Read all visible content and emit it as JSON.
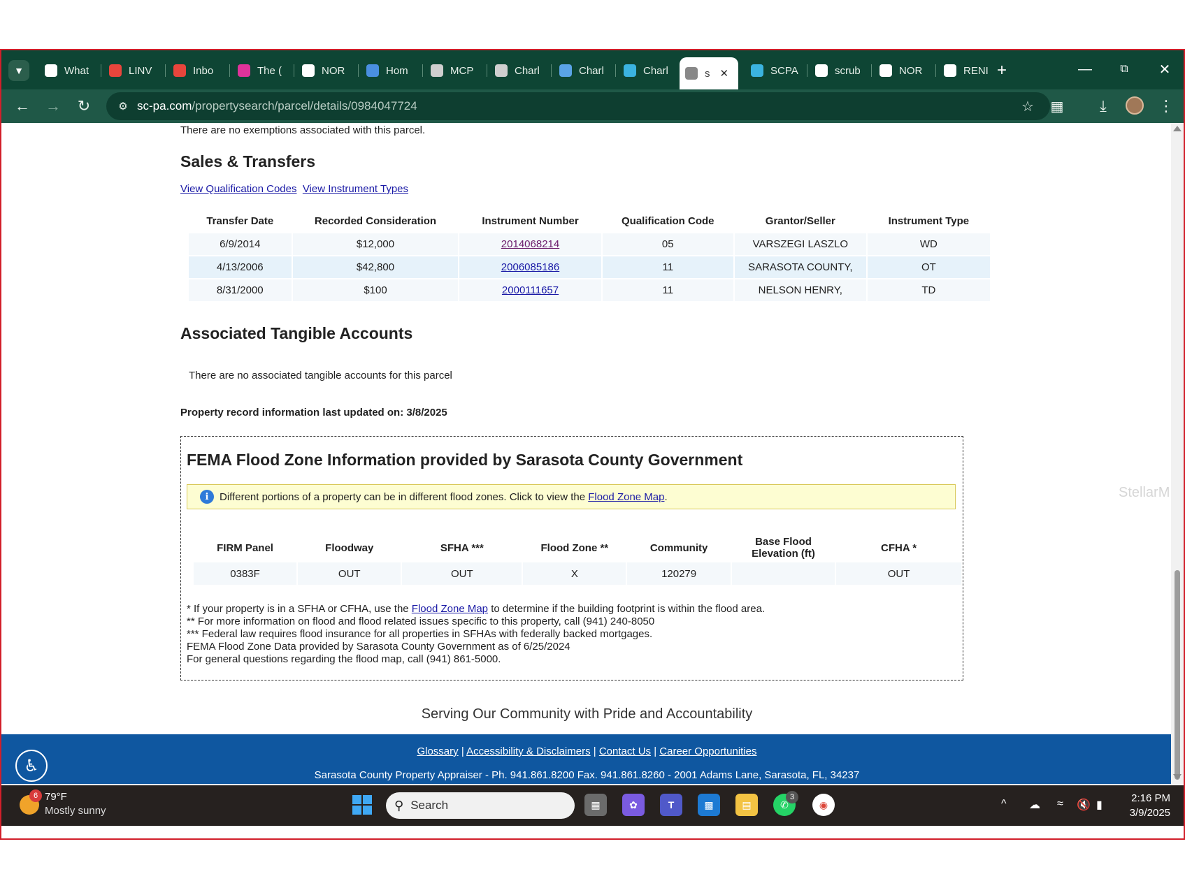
{
  "browser": {
    "tabs": [
      {
        "label": "What",
        "icon": "chrome-icon",
        "color": "#ffffff"
      },
      {
        "label": "LINV",
        "icon": "gmail-icon",
        "color": "#e8453c"
      },
      {
        "label": "Inbo",
        "icon": "gmail-icon",
        "color": "#e8453c"
      },
      {
        "label": "The (",
        "icon": "grid-app-icon",
        "color": "#e0339a"
      },
      {
        "label": "NOR",
        "icon": "doc-icon",
        "color": "#ffffff"
      },
      {
        "label": "Hom",
        "icon": "wave-icon",
        "color": "#4a8fe0"
      },
      {
        "label": "MCP",
        "icon": "circle-logo-icon",
        "color": "#cfcfcf"
      },
      {
        "label": "Charl",
        "icon": "seal-icon",
        "color": "#cfcfcf"
      },
      {
        "label": "Charl",
        "icon": "shield-logo-icon",
        "color": "#5aa3e6"
      },
      {
        "label": "Charl",
        "icon": "s-logo-icon",
        "color": "#3bb3e0"
      },
      {
        "label": "s",
        "icon": "globe-icon",
        "color": "#888888",
        "active": true
      },
      {
        "label": "SCPA",
        "icon": "s-logo-icon",
        "color": "#3bb3e0"
      },
      {
        "label": "scrub",
        "icon": "doc-icon",
        "color": "#ffffff"
      },
      {
        "label": "NOR",
        "icon": "doc-icon",
        "color": "#ffffff"
      },
      {
        "label": "RENI",
        "icon": "google-icon",
        "color": "#ffffff"
      }
    ],
    "new_tab_label": "+",
    "url_host": "sc-pa.com",
    "url_path": "/propertysearch/parcel/details/0984047724"
  },
  "page": {
    "exemptions_text": "There are no exemptions associated with this parcel.",
    "sales_heading": "Sales & Transfers",
    "link_qualification": "View Qualification Codes",
    "link_instrument": "View Instrument Types",
    "sales_columns": [
      "Transfer Date",
      "Recorded Consideration",
      "Instrument Number",
      "Qualification Code",
      "Grantor/Seller",
      "Instrument Type"
    ],
    "sales_rows": [
      {
        "date": "6/9/2014",
        "consideration": "$12,000",
        "instrument": "2014068214",
        "qual": "05",
        "grantor": "VARSZEGI LASZLO",
        "type": "WD"
      },
      {
        "date": "4/13/2006",
        "consideration": "$42,800",
        "instrument": "2006085186",
        "qual": "11",
        "grantor": "SARASOTA COUNTY,",
        "type": "OT"
      },
      {
        "date": "8/31/2000",
        "consideration": "$100",
        "instrument": "2000111657",
        "qual": "11",
        "grantor": "NELSON HENRY,",
        "type": "TD"
      }
    ],
    "tangible_heading": "Associated Tangible Accounts",
    "tangible_text": "There are no associated tangible accounts for this parcel",
    "updated_text": "Property record information last updated on: 3/8/2025",
    "fema": {
      "heading": "FEMA Flood Zone Information provided by Sarasota County Government",
      "notice_text": "Different portions of a property can be in different flood zones. Click to view the",
      "notice_link": "Flood Zone Map",
      "columns": [
        "FIRM Panel",
        "Floodway",
        "SFHA ***",
        "Flood Zone **",
        "Community",
        "Base Flood Elevation (ft)",
        "CFHA *"
      ],
      "row": [
        "0383F",
        "OUT",
        "OUT",
        "X",
        "120279",
        "",
        "OUT"
      ],
      "note1_pre": "* If your property is in a SFHA or CFHA, use the",
      "note1_link": "Flood Zone Map",
      "note1_post": "to determine if the building footprint is within the flood area.",
      "note2": "** For more information on flood and flood related issues specific to this property, call (941) 240-8050",
      "note3": "*** Federal law requires flood insurance for all properties in SFHAs with federally backed mortgages.",
      "note4": "FEMA Flood Zone Data provided by Sarasota County Government as of 6/25/2024",
      "note5": "For general questions regarding the flood map, call (941) 861-5000."
    },
    "tagline": "Serving Our Community with Pride and Accountability",
    "footer_links": [
      "Glossary",
      "Accessibility & Disclaimers",
      "Contact Us",
      "Career Opportunities"
    ],
    "footer_address": "Sarasota County Property Appraiser - Ph. 941.861.8200 Fax. 941.861.8260 - 2001 Adams Lane, Sarasota, FL, 34237",
    "watermark": "StellarMLS"
  },
  "taskbar": {
    "weather_badge": "6",
    "temperature": "79°F",
    "condition": "Mostly sunny",
    "search_placeholder": "Search",
    "whatsapp_badge": "3",
    "time": "2:16 PM",
    "date": "3/9/2025"
  }
}
